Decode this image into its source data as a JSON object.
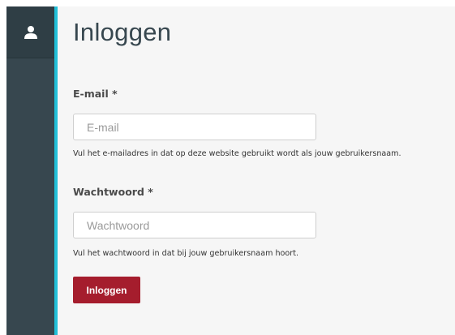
{
  "page": {
    "title": "Inloggen"
  },
  "sidebar": {
    "icon": "user-icon"
  },
  "form": {
    "email": {
      "label": "E-mail",
      "required_marker": "*",
      "placeholder": "E-mail",
      "value": "",
      "help": "Vul het e-mailadres in dat op deze website gebruikt wordt als jouw gebruikersnaam."
    },
    "password": {
      "label": "Wachtwoord",
      "required_marker": "*",
      "placeholder": "Wachtwoord",
      "value": "",
      "help": "Vul het wachtwoord in dat bij jouw gebruikersnaam hoort."
    },
    "submit_label": "Inloggen"
  },
  "colors": {
    "sidebar": "#37474f",
    "accent": "#22c0d8",
    "button": "#a51d2d",
    "background": "#f6f6f6"
  }
}
